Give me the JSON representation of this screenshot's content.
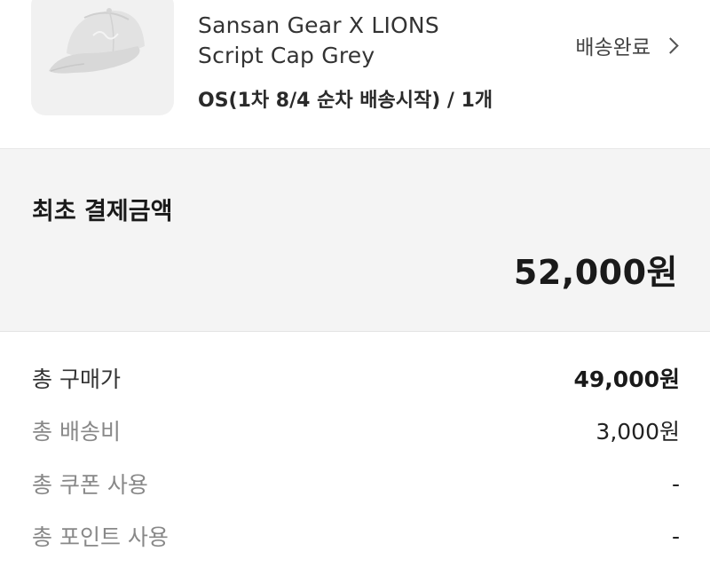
{
  "product": {
    "image_alt": "cap-image",
    "name_line1": "Sansan Gear X LIONS",
    "name_line2": "Script Cap Grey",
    "option": "OS(1차 8/4 순차 배송시작) / 1개",
    "status": "배송완료",
    "status_icon": "chevron-right-icon"
  },
  "initial_payment": {
    "title": "최초 결제금액",
    "amount": "52,000원"
  },
  "breakdown": [
    {
      "label": "총 구매가",
      "value": "49,000원"
    },
    {
      "label": "총 배송비",
      "value": "3,000원"
    },
    {
      "label": "총 쿠폰 사용",
      "value": "-"
    },
    {
      "label": "총 포인트 사용",
      "value": "-"
    }
  ]
}
